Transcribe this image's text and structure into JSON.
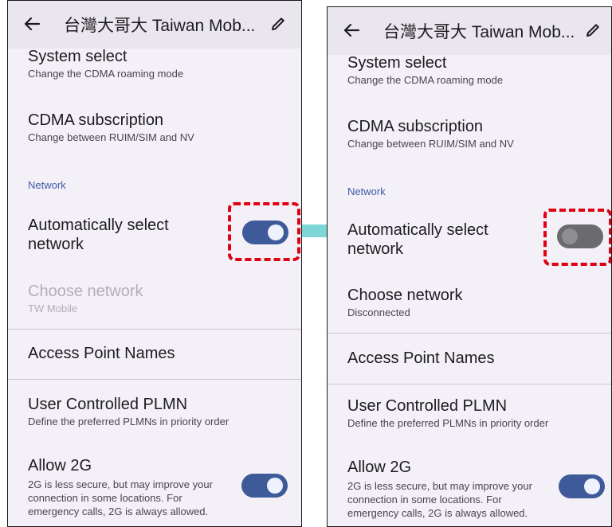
{
  "left": {
    "header": {
      "title": "台灣大哥大 Taiwan Mob..."
    },
    "items": {
      "system_select": {
        "title": "System select",
        "subtitle": "Change the CDMA roaming mode"
      },
      "cdma_subscription": {
        "title": "CDMA subscription",
        "subtitle": "Change between RUIM/SIM and NV"
      },
      "section_network": "Network",
      "auto_select": {
        "title": "Automatically select network",
        "toggle": "on"
      },
      "choose_network": {
        "title": "Choose network",
        "subtitle": "TW Mobile",
        "enabled": false
      },
      "apn": {
        "title": "Access Point Names"
      },
      "plmn": {
        "title": "User Controlled PLMN",
        "subtitle": "Define the preferred PLMNs in priority order"
      },
      "allow_2g": {
        "title": "Allow 2G",
        "subtitle": "2G is less secure, but may improve your connection in some locations. For emergency calls, 2G is always allowed.",
        "toggle": "on"
      }
    }
  },
  "right": {
    "header": {
      "title": "台灣大哥大 Taiwan Mob..."
    },
    "items": {
      "system_select": {
        "title": "System select",
        "subtitle": "Change the CDMA roaming mode"
      },
      "cdma_subscription": {
        "title": "CDMA subscription",
        "subtitle": "Change between RUIM/SIM and NV"
      },
      "section_network": "Network",
      "auto_select": {
        "title": "Automatically select network",
        "toggle": "off"
      },
      "choose_network": {
        "title": "Choose network",
        "subtitle": "Disconnected",
        "enabled": true
      },
      "apn": {
        "title": "Access Point Names"
      },
      "plmn": {
        "title": "User Controlled PLMN",
        "subtitle": "Define the preferred PLMNs in priority order"
      },
      "allow_2g": {
        "title": "Allow 2G",
        "subtitle": "2G is less secure, but may improve your connection in some locations. For emergency calls, 2G is always allowed.",
        "toggle": "on"
      }
    }
  },
  "colors": {
    "accent": "#3f5a99",
    "highlight": "#e00012",
    "arrow": "#7fd6d6",
    "section": "#3e5aa8"
  },
  "icons": {
    "back": "arrow-left-icon",
    "edit": "pencil-icon"
  }
}
